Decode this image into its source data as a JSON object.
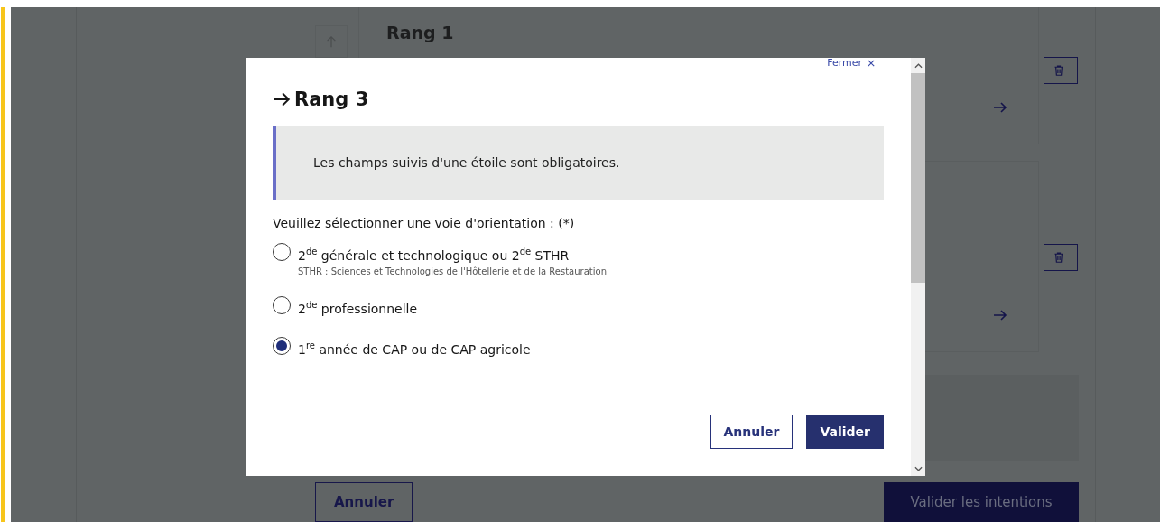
{
  "background": {
    "cards": [
      {
        "kind": "titled",
        "title": "Rang 1"
      },
      {
        "kind": "plain"
      }
    ],
    "buttons": [
      {
        "label": "Annuler",
        "kind": "secondary"
      },
      {
        "label": "Valider les intentions",
        "kind": "primary"
      }
    ]
  },
  "modal": {
    "close_link": "Fermer",
    "title": "Rang 3",
    "notice": "Les champs suivis d'une étoile sont obligatoires.",
    "question": "Veuillez sélectionner une voie d'orientation : (*)",
    "options": [
      {
        "label": "2$^{de}$ générale et technologique ou 2$^{de}$ STHR",
        "hint": "STHR : Sciences et Technologies de l'Hôtellerie et de la Restauration",
        "selected": false
      },
      {
        "label": "2$^{de}$ professionnelle",
        "selected": false
      },
      {
        "label": "1$^{re}$ année de CAP ou de CAP agricole",
        "selected": true
      }
    ],
    "buttons": [
      {
        "label": "Annuler",
        "kind": "secondary"
      },
      {
        "label": "Valider",
        "kind": "primary"
      }
    ]
  }
}
